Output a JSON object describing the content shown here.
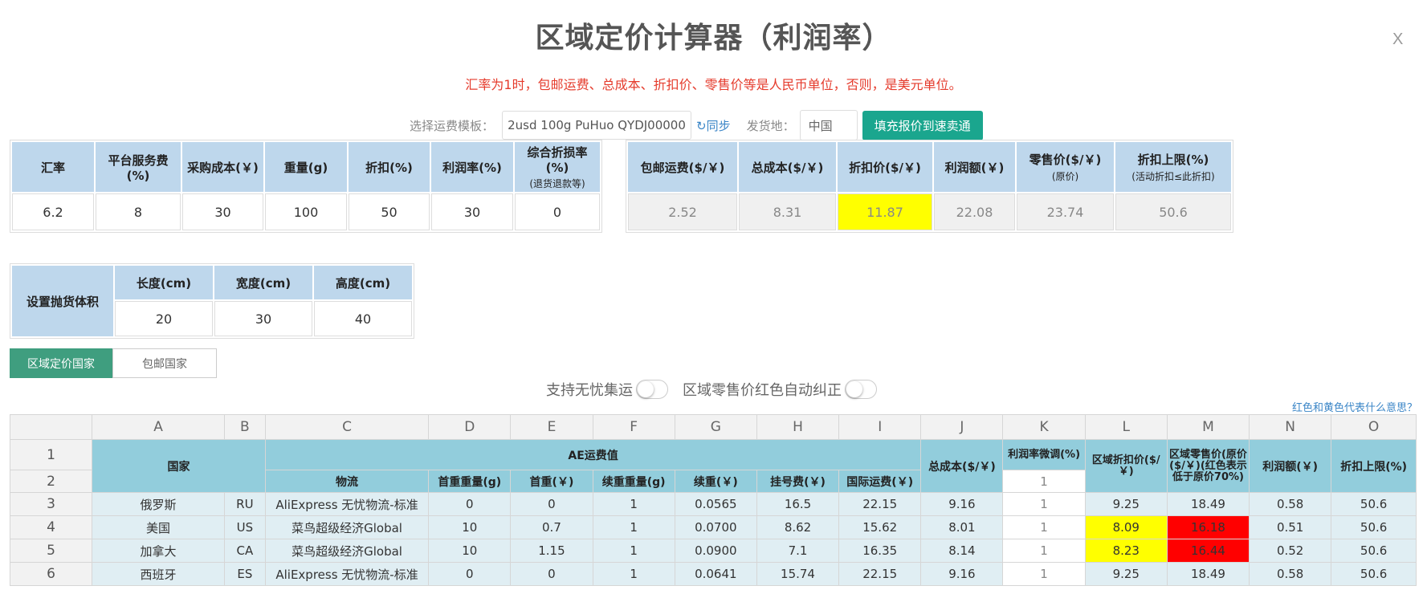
{
  "title": "区域定价计算器（利润率）",
  "close_label": "X",
  "notice": "汇率为1时，包邮运费、总成本、折扣价、零售价等是人民币单位，否则，是美元单位。",
  "template": {
    "label": "选择运费模板：",
    "value": "2usd 100g PuHuo QYDJ00000",
    "sync_label": "↻同步",
    "origin_label": "发货地：",
    "origin_value": "中国",
    "fill_button": "填充报价到速卖通"
  },
  "params": {
    "headers": [
      {
        "label": "汇率",
        "sub": ""
      },
      {
        "label": "平台服务费(%)",
        "sub": ""
      },
      {
        "label": "采购成本(￥)",
        "sub": ""
      },
      {
        "label": "重量(g)",
        "sub": ""
      },
      {
        "label": "折扣(%)",
        "sub": ""
      },
      {
        "label": "利润率(%)",
        "sub": ""
      },
      {
        "label": "综合折损率(%)",
        "sub": "(退货退款等)"
      }
    ],
    "values": [
      "6.2",
      "8",
      "30",
      "100",
      "50",
      "30",
      "0"
    ]
  },
  "results": {
    "headers": [
      {
        "label": "包邮运费($/￥)",
        "sub": ""
      },
      {
        "label": "总成本($/￥)",
        "sub": ""
      },
      {
        "label": "折扣价($/￥)",
        "sub": ""
      },
      {
        "label": "利润额(￥)",
        "sub": ""
      },
      {
        "label": "零售价($/￥)",
        "sub": "(原价)"
      },
      {
        "label": "折扣上限(%)",
        "sub": "(活动折扣≤此折扣)"
      }
    ],
    "values": [
      "2.52",
      "8.31",
      "11.87",
      "22.08",
      "23.74",
      "50.6"
    ],
    "highlight_color": "#ffff00"
  },
  "volume": {
    "label": "设置抛货体积",
    "headers": [
      "长度(cm)",
      "宽度(cm)",
      "高度(cm)"
    ],
    "values": [
      "20",
      "30",
      "40"
    ]
  },
  "tabs": [
    "区域定价国家",
    "包邮国家"
  ],
  "switches": [
    "支持无忧集运",
    "区域零售价红色自动纠正"
  ],
  "help_link": "红色和黄色代表什么意思？",
  "grid": {
    "col_letters": [
      "A",
      "B",
      "C",
      "D",
      "E",
      "F",
      "G",
      "H",
      "I",
      "J",
      "K",
      "L",
      "M",
      "N",
      "O"
    ],
    "row_numbers": [
      "1",
      "2",
      "3",
      "4",
      "5",
      "6"
    ],
    "headers": {
      "country": "国家",
      "ae_shipping": "AE运费值",
      "logistics": "物流",
      "first_weight": "首重重量(g)",
      "first_cost": "首重(￥)",
      "cont_weight": "续重重量(g)",
      "cont_cost": "续重(￥)",
      "reg_fee": "挂号费(￥)",
      "intl_shipping": "国际运费(￥)",
      "total_cost": "总成本($/￥)",
      "margin_adj": "利润率微调(%)",
      "margin_adj_value": "1",
      "region_discount": "区域折扣价($/￥)",
      "region_retail": "区域零售价(原价($/￥)(红色表示低于原价70%)",
      "profit": "利润额(￥)",
      "discount_cap": "折扣上限(%)"
    },
    "rows": [
      {
        "country": "俄罗斯",
        "code": "RU",
        "logistics": "AliExpress 无忧物流-标准",
        "first_weight": "0",
        "first_cost": "0",
        "cont_weight": "1",
        "cont_cost": "0.0565",
        "reg_fee": "16.5",
        "intl": "22.15",
        "total": "9.16",
        "adj": "1",
        "disc": "9.25",
        "retail": "18.49",
        "profit": "0.58",
        "cap": "50.6",
        "disc_flag": "",
        "retail_flag": ""
      },
      {
        "country": "美国",
        "code": "US",
        "logistics": "菜鸟超级经济Global",
        "first_weight": "10",
        "first_cost": "0.7",
        "cont_weight": "1",
        "cont_cost": "0.0700",
        "reg_fee": "8.62",
        "intl": "15.62",
        "total": "8.01",
        "adj": "1",
        "disc": "8.09",
        "retail": "16.18",
        "profit": "0.51",
        "cap": "50.6",
        "disc_flag": "yellow",
        "retail_flag": "red"
      },
      {
        "country": "加拿大",
        "code": "CA",
        "logistics": "菜鸟超级经济Global",
        "first_weight": "10",
        "first_cost": "1.15",
        "cont_weight": "1",
        "cont_cost": "0.0900",
        "reg_fee": "7.1",
        "intl": "16.35",
        "total": "8.14",
        "adj": "1",
        "disc": "8.23",
        "retail": "16.44",
        "profit": "0.52",
        "cap": "50.6",
        "disc_flag": "yellow",
        "retail_flag": "red"
      },
      {
        "country": "西班牙",
        "code": "ES",
        "logistics": "AliExpress 无忧物流-标准",
        "first_weight": "0",
        "first_cost": "0",
        "cont_weight": "1",
        "cont_cost": "0.0641",
        "reg_fee": "15.74",
        "intl": "22.15",
        "total": "9.16",
        "adj": "1",
        "disc": "9.25",
        "retail": "18.49",
        "profit": "0.58",
        "cap": "50.6",
        "disc_flag": "",
        "retail_flag": ""
      }
    ]
  }
}
